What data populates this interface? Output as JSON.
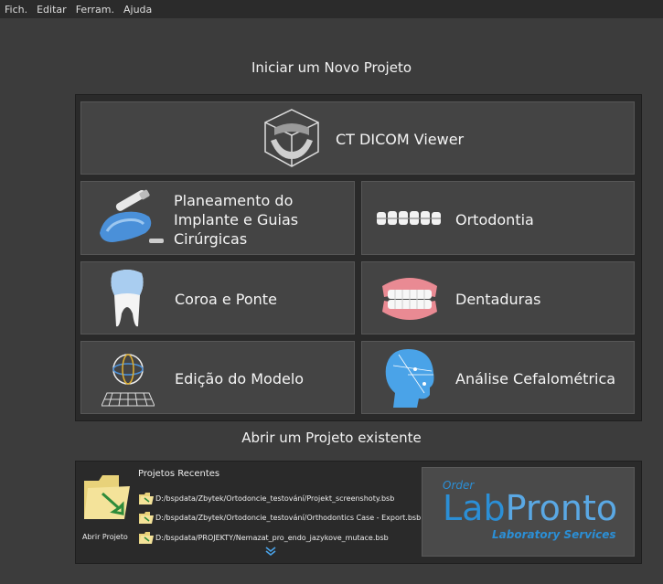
{
  "menu": [
    "Fich.",
    "Editar",
    "Ferram.",
    "Ajuda"
  ],
  "new_project": {
    "title": "Iniciar um Novo Projeto",
    "ct_viewer": "CT DICOM Viewer",
    "implant_line1": "Planeamento do",
    "implant_line2": "Implante e Guias",
    "implant_line3": "Cirúrgicas",
    "orthodontics": "Ortodontia",
    "crown_bridge": "Coroa e Ponte",
    "dentures": "Dentaduras",
    "model_edit": "Edição do Modelo",
    "cephalometric": "Análise Cefalométrica"
  },
  "open_project": {
    "title": "Abrir um Projeto existente",
    "open_label": "Abrir Projeto",
    "recent_title": "Projetos Recentes",
    "recent_files": [
      "D:/bspdata/Zbytek/Ortodoncie_testování/Projekt_screenshoty.bsb",
      "D:/bspdata/Zbytek/Ortodoncie_testování/Orthodontics Case - Export.bsb",
      "D:/bspdata/PROJEKTY/Nemazat_pro_endo_jazykove_mutace.bsb"
    ]
  },
  "logo": {
    "order": "Order",
    "lab": "Lab",
    "pronto": "Pronto",
    "services": "Laboratory Services"
  },
  "colors": {
    "background": "#3c3c3c",
    "panel": "#2a2a2a",
    "tile": "#444444",
    "logo_blue": "#2b8fd6"
  }
}
